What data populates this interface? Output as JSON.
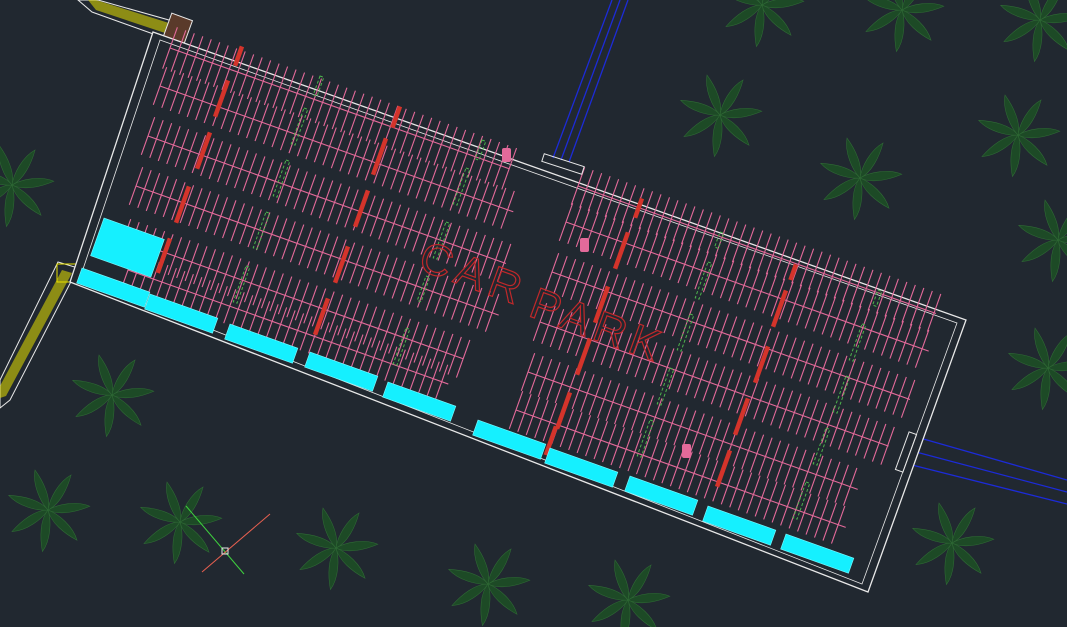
{
  "drawing": {
    "label_words": [
      "CAR",
      "PARK"
    ],
    "colors": {
      "background": "#212830",
      "outline": "#e8e8e8",
      "stalls": "#e36a9a",
      "islands": "#d4342b",
      "planting": "#4db34d",
      "canopy": "#15f0ff",
      "trees": "#1d4a26",
      "hatch": "#e8e000",
      "utility": "#1c2bd8",
      "text": "#c0282a"
    },
    "tree_symbol": "palm-tree-icon"
  }
}
